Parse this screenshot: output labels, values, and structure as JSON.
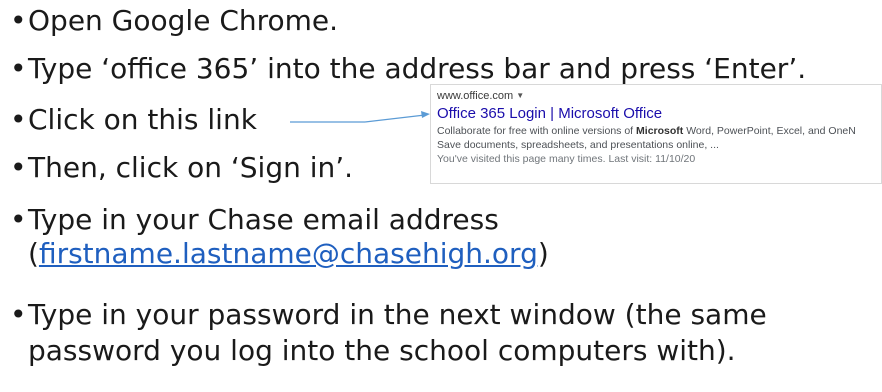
{
  "instructions": {
    "bullet": "•",
    "step1": "Open Google Chrome.",
    "step2": "Type ‘office 365’ into the address bar and press ‘Enter’.",
    "step3": "Click on this link",
    "step4": "Then, click on ‘Sign in’.",
    "step5_line1": "Type in your Chase email address",
    "step5_open": "(",
    "step5_email": "firstname.lastname@chasehigh.org",
    "step5_close": ")",
    "step6_line1": "Type in your password in the next window (the same",
    "step6_line2": "password you log into the school computers with)."
  },
  "search_result": {
    "url": "www.office.com",
    "url_caret": "▼",
    "title": "Office 365 Login | Microsoft Office",
    "desc_line1_a": "Collaborate for free with online versions of ",
    "desc_line1_bold": "Microsoft",
    "desc_line1_b": " Word, PowerPoint, Excel, and OneN",
    "desc_line2": "Save documents, spreadsheets, and presentations online, ...",
    "visited": "You've visited this page many times. Last visit: 11/10/20"
  },
  "colors": {
    "link": "#1f5fbf",
    "result_title": "#1a0dab",
    "arrow": "#5b9bd5"
  }
}
